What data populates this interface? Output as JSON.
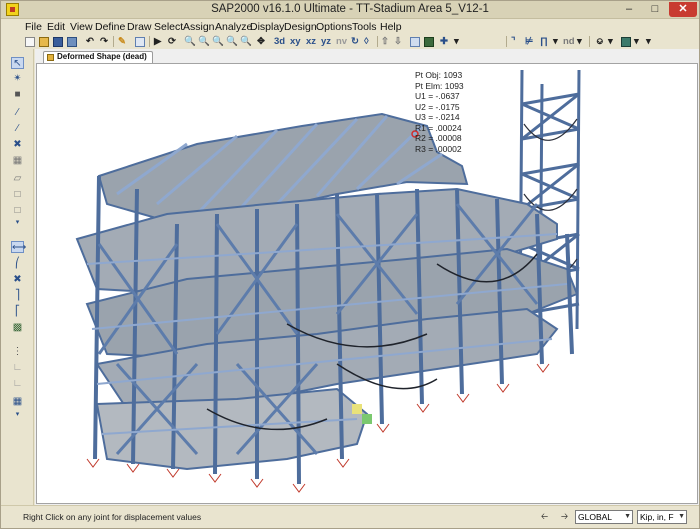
{
  "window": {
    "title": "SAP2000 v16.1.0 Ultimate  - TT-Stadium Area 5_V12-1",
    "minimize_glyph": "–",
    "maximize_glyph": "□",
    "close_glyph": "✕"
  },
  "menu": [
    "File",
    "Edit",
    "View",
    "Define",
    "Draw",
    "Select",
    "Assign",
    "Analyze",
    "Display",
    "Design",
    "Options",
    "Tools",
    "Help"
  ],
  "toolbar": {
    "axes_labels": [
      "xy",
      "xz",
      "yz",
      "nv"
    ],
    "nd_label": "nd"
  },
  "tab": {
    "label": "Deformed Shape (dead)"
  },
  "displacement": {
    "pt_obj": "Pt Obj: 1093",
    "pt_elm": "Pt Elm: 1093",
    "u1": "U1 = -.0637",
    "u2": "U2 = -.0175",
    "u3": "U3 = -.0214",
    "r1": "R1 = .00024",
    "r2": "R2 = .00008",
    "r3": "R3 = .00002"
  },
  "status": {
    "message": "Right Click on any joint for displacement values",
    "coord_system": "GLOBAL",
    "units": "Kip, in, F"
  },
  "colors": {
    "frame_member": "#4e6d9c",
    "frame_member_light": "#8fa8cf",
    "slab": "#9aa3ad",
    "support": "#c0392b",
    "highlight_joint": "#d22c2c"
  }
}
